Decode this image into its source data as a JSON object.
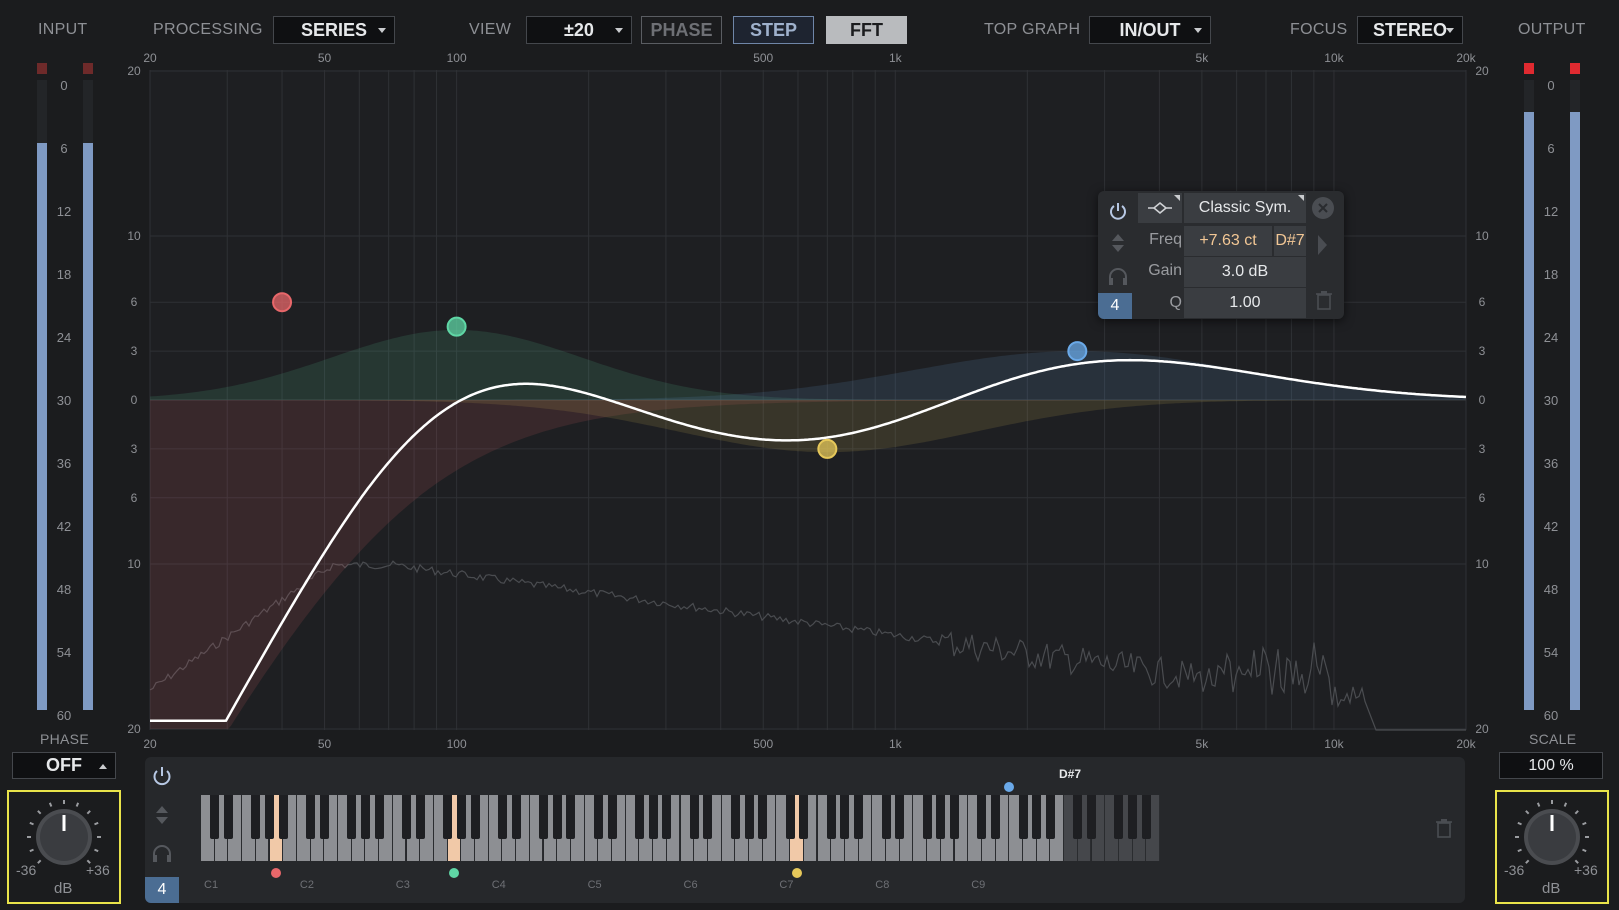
{
  "header": {
    "input_label": "INPUT",
    "processing_label": "PROCESSING",
    "processing_value": "SERIES",
    "view_label": "VIEW",
    "view_value": "±20",
    "phase_btn": "PHASE",
    "step_btn": "STEP",
    "fft_btn": "FFT",
    "top_graph_label": "TOP GRAPH",
    "top_graph_value": "IN/OUT",
    "focus_label": "FOCUS",
    "focus_value": "STEREO",
    "output_label": "OUTPUT"
  },
  "colors": {
    "accent": "#7f9ac3",
    "band1": "#e8676a",
    "band2": "#5fd6a5",
    "band3": "#e6c85a",
    "band4": "#6aa9e8",
    "highlight": "#e9e34a",
    "key_highlight": "#f1c9a8"
  },
  "meter_scale": [
    "0",
    "6",
    "12",
    "18",
    "24",
    "30",
    "36",
    "42",
    "48",
    "54",
    "60"
  ],
  "input_meter": {
    "level_db": -6
  },
  "output_meter": {
    "level_db": -3
  },
  "freq_top_labels": [
    "20",
    "50",
    "100",
    "500",
    "1k",
    "5k",
    "10k",
    "20k"
  ],
  "freq_bottom_labels": [
    "20",
    "50",
    "100",
    "500",
    "1k",
    "5k",
    "10k",
    "20k"
  ],
  "db_left_labels": [
    "20",
    "10",
    "6",
    "3",
    "0",
    "3",
    "6",
    "10",
    "20"
  ],
  "db_right_labels": [
    "20",
    "10",
    "6",
    "3",
    "0",
    "3",
    "6",
    "10",
    "20"
  ],
  "bands": [
    {
      "name": "band-1",
      "freq_hz": 40,
      "gain_db": 6,
      "type": "high-pass"
    },
    {
      "name": "band-2",
      "freq_hz": 100,
      "gain_db": 4.5,
      "type": "bell"
    },
    {
      "name": "band-3",
      "freq_hz": 700,
      "gain_db": -3,
      "type": "bell"
    },
    {
      "name": "band-4",
      "freq_hz": 2600,
      "gain_db": 3,
      "type": "bell"
    }
  ],
  "popup": {
    "type": "Classic Sym.",
    "freq_label": "Freq",
    "freq_value": "+7.63 ct",
    "note": "D#7",
    "gain_label": "Gain",
    "gain_value": "3.0 dB",
    "q_label": "Q",
    "q_value": "1.00",
    "band_number": "4"
  },
  "phase": {
    "label": "PHASE",
    "value": "OFF"
  },
  "scale": {
    "label": "SCALE",
    "value": "100 %"
  },
  "input_knob": {
    "min": "-36",
    "max": "+36",
    "unit": "dB"
  },
  "output_knob": {
    "min": "-36",
    "max": "+36",
    "unit": "dB"
  },
  "keyboard": {
    "band_number": "4",
    "active_note": "D#7",
    "octaves": [
      "C1",
      "C2",
      "C3",
      "C4",
      "C5",
      "C6",
      "C7",
      "C8",
      "C9"
    ]
  }
}
